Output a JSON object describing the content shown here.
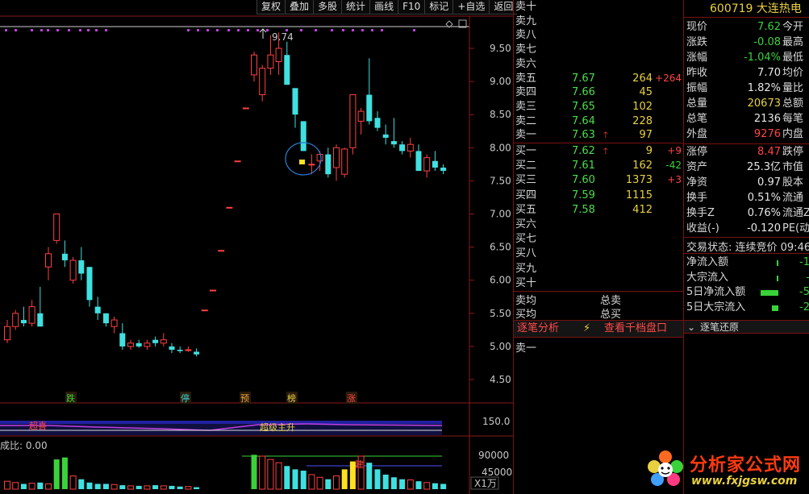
{
  "toolbar": {
    "items": [
      "复权",
      "叠加",
      "多股",
      "统计",
      "画线",
      "F10",
      "标记",
      "+自选",
      "返回"
    ]
  },
  "chart": {
    "price_labels": [
      "9.50",
      "9.00",
      "8.50",
      "8.00",
      "7.50",
      "7.00",
      "6.50",
      "6.00",
      "5.50",
      "5.00",
      "4.50"
    ],
    "max_label": "9.74",
    "tags": [
      {
        "text": "跌",
        "color": "#3ad23a"
      },
      {
        "text": "停",
        "color": "#3ad2d2"
      },
      {
        "text": "预",
        "color": "#e8a040"
      },
      {
        "text": "榜",
        "color": "#e8d040"
      },
      {
        "text": "涨",
        "color": "#ff4444"
      }
    ],
    "indicator": {
      "scale": "150.0",
      "label_left": "超喜",
      "label_right": "超级主升"
    },
    "volume": {
      "title": "成比: 0.00",
      "label_high": "90000",
      "label_mid": "45000",
      "unit": "X1万",
      "mark": "建"
    }
  },
  "chart_data": {
    "type": "candlestick",
    "ylim": [
      4.4,
      9.9
    ],
    "candles": [
      [
        5.1,
        5.4,
        5.05,
        5.3
      ],
      [
        5.3,
        5.55,
        5.25,
        5.5
      ],
      [
        5.4,
        5.6,
        5.3,
        5.35
      ],
      [
        5.35,
        5.7,
        5.3,
        5.6
      ],
      [
        5.5,
        5.9,
        5.45,
        5.3
      ],
      [
        6.2,
        6.5,
        6.0,
        6.4
      ],
      [
        6.6,
        7.0,
        6.55,
        7.0
      ],
      [
        6.4,
        6.6,
        6.2,
        6.3
      ],
      [
        6.0,
        6.35,
        5.95,
        6.3
      ],
      [
        6.3,
        6.5,
        6.0,
        6.1
      ],
      [
        6.2,
        6.2,
        5.6,
        5.7
      ],
      [
        5.6,
        5.75,
        5.4,
        5.5
      ],
      [
        5.5,
        5.5,
        5.3,
        5.35
      ],
      [
        5.3,
        5.45,
        5.2,
        5.4
      ],
      [
        5.2,
        5.35,
        4.95,
        5.0
      ],
      [
        5.0,
        5.1,
        4.95,
        5.05
      ],
      [
        5.05,
        5.1,
        4.98,
        5.0
      ],
      [
        5.0,
        5.1,
        4.95,
        5.05
      ],
      [
        5.1,
        5.15,
        5.0,
        5.05
      ],
      [
        5.05,
        5.2,
        5.0,
        5.1
      ],
      [
        5.0,
        5.05,
        4.9,
        4.95
      ],
      [
        4.95,
        5.0,
        4.9,
        4.93
      ],
      [
        4.95,
        5.0,
        4.92,
        4.95
      ],
      [
        4.92,
        4.97,
        4.85,
        4.88
      ],
      [
        5.55,
        5.55,
        5.55,
        5.55
      ],
      [
        5.85,
        5.85,
        5.85,
        5.85
      ],
      [
        6.45,
        6.45,
        6.45,
        6.45
      ],
      [
        7.1,
        7.1,
        7.1,
        7.1
      ],
      [
        7.8,
        7.8,
        7.8,
        7.8
      ],
      [
        8.6,
        8.6,
        8.6,
        8.6
      ],
      [
        9.1,
        9.45,
        9.0,
        9.4
      ],
      [
        8.8,
        9.25,
        8.7,
        9.2
      ],
      [
        9.2,
        9.7,
        9.1,
        9.4
      ],
      [
        9.3,
        9.74,
        9.1,
        9.5
      ],
      [
        9.4,
        9.6,
        8.95,
        8.95
      ],
      [
        8.9,
        8.9,
        8.3,
        8.5
      ],
      [
        8.4,
        8.4,
        7.95,
        7.95
      ],
      [
        7.75,
        7.9,
        7.6,
        7.75
      ],
      [
        7.8,
        7.95,
        7.65,
        7.9
      ],
      [
        7.9,
        8.0,
        7.55,
        7.6
      ],
      [
        7.7,
        8.05,
        7.5,
        8.0
      ],
      [
        7.6,
        8.0,
        7.55,
        7.98
      ],
      [
        8.0,
        8.8,
        7.9,
        8.8
      ],
      [
        8.4,
        8.6,
        8.2,
        8.55
      ],
      [
        8.8,
        9.35,
        8.35,
        8.4
      ],
      [
        8.45,
        8.55,
        8.25,
        8.3
      ],
      [
        8.2,
        8.35,
        8.05,
        8.15
      ],
      [
        8.1,
        8.45,
        8.0,
        8.05
      ],
      [
        8.05,
        8.1,
        7.9,
        7.95
      ],
      [
        7.95,
        8.15,
        7.85,
        8.05
      ],
      [
        7.95,
        8.05,
        7.65,
        7.65
      ],
      [
        7.65,
        7.9,
        7.55,
        7.85
      ],
      [
        7.8,
        7.95,
        7.65,
        7.7
      ],
      [
        7.7,
        7.75,
        7.6,
        7.65
      ]
    ],
    "volumes": [
      12,
      10,
      8,
      9,
      10,
      8,
      45,
      48,
      20,
      15,
      10,
      8,
      8,
      7,
      6,
      5,
      5,
      5,
      6,
      5,
      5,
      4,
      4,
      3,
      0,
      0,
      0,
      0,
      0,
      0,
      52,
      50,
      45,
      40,
      35,
      30,
      28,
      22,
      18,
      15,
      20,
      30,
      42,
      50,
      40,
      30,
      22,
      18,
      15,
      14,
      12,
      10,
      9,
      8
    ]
  },
  "book": {
    "sells": [
      {
        "label": "卖十",
        "price": "",
        "vol": "",
        "chg": ""
      },
      {
        "label": "卖九",
        "price": "",
        "vol": "",
        "chg": ""
      },
      {
        "label": "卖八",
        "price": "",
        "vol": "",
        "chg": ""
      },
      {
        "label": "卖七",
        "price": "",
        "vol": "",
        "chg": ""
      },
      {
        "label": "卖六",
        "price": "",
        "vol": "",
        "chg": ""
      },
      {
        "label": "卖五",
        "price": "7.67",
        "vol": "264",
        "chg": "+264"
      },
      {
        "label": "卖四",
        "price": "7.66",
        "vol": "45",
        "chg": ""
      },
      {
        "label": "卖三",
        "price": "7.65",
        "vol": "102",
        "chg": ""
      },
      {
        "label": "卖二",
        "price": "7.64",
        "vol": "228",
        "chg": ""
      },
      {
        "label": "卖一",
        "price": "7.63",
        "vol": "97",
        "chg": "",
        "arrow": "🡑"
      }
    ],
    "buys": [
      {
        "label": "买一",
        "price": "7.62",
        "vol": "9",
        "chg": "+9",
        "arrow": "🡑"
      },
      {
        "label": "买二",
        "price": "7.61",
        "vol": "162",
        "chg": "-42"
      },
      {
        "label": "买三",
        "price": "7.60",
        "vol": "1373",
        "chg": "+3"
      },
      {
        "label": "买四",
        "price": "7.59",
        "vol": "1115",
        "chg": ""
      },
      {
        "label": "买五",
        "price": "7.58",
        "vol": "412",
        "chg": ""
      },
      {
        "label": "买六",
        "price": "",
        "vol": "",
        "chg": ""
      },
      {
        "label": "买七",
        "price": "",
        "vol": "",
        "chg": ""
      },
      {
        "label": "买八",
        "price": "",
        "vol": "",
        "chg": ""
      },
      {
        "label": "买九",
        "price": "",
        "vol": "",
        "chg": ""
      },
      {
        "label": "买十",
        "price": "",
        "vol": "",
        "chg": ""
      }
    ],
    "avg_sell": "卖均",
    "total_sell": "总卖",
    "avg_buy": "买均",
    "total_buy": "总买",
    "tab_tick": "逐笔分析",
    "tab_depth": "查看千档盘口",
    "tick_first": "卖一"
  },
  "quote": {
    "code_name": "600719 大连热电",
    "rows": [
      {
        "k": "现价",
        "v": "7.62",
        "vc": "green",
        "k2": "今开"
      },
      {
        "k": "涨跌",
        "v": "-0.08",
        "vc": "green",
        "k2": "最高"
      },
      {
        "k": "涨幅",
        "v": "-1.04%",
        "vc": "green",
        "k2": "最低"
      },
      {
        "k": "昨收",
        "v": "7.70",
        "vc": "white",
        "k2": "均价"
      },
      {
        "k": "振幅",
        "v": "1.82%",
        "vc": "white",
        "k2": "量比"
      },
      {
        "k": "总量",
        "v": "20673",
        "vc": "yellow",
        "k2": "总额"
      },
      {
        "k": "总笔",
        "v": "2136",
        "vc": "white",
        "k2": "每笔"
      },
      {
        "k": "外盘",
        "v": "9276",
        "vc": "red",
        "k2": "内盘"
      }
    ],
    "rows2": [
      {
        "k": "涨停",
        "v": "8.47",
        "vc": "red",
        "k2": "跌停"
      },
      {
        "k": "资产",
        "v": "25.3亿",
        "vc": "white",
        "k2": "市值"
      },
      {
        "k": "净资",
        "v": "0.97",
        "vc": "white",
        "k2": "股本"
      },
      {
        "k": "换手",
        "v": "0.51%",
        "vc": "white",
        "k2": "流通"
      },
      {
        "k": "换手Z",
        "v": "0.76%",
        "vc": "white",
        "k2": "流通Z"
      },
      {
        "k": "收益(-)",
        "v": "-0.120",
        "vc": "white",
        "k2": "PE(动"
      }
    ],
    "trade_state": "交易状态: 连续竞价 09:46",
    "flows": [
      {
        "k": "净流入额",
        "bar": 0.02,
        "v": "-1"
      },
      {
        "k": "大宗流入",
        "bar": 0.0,
        "v": "-"
      },
      {
        "k": "5日净流入额",
        "bar": 0.9,
        "v": "-5"
      },
      {
        "k": "5日大宗流入",
        "bar": 0.35,
        "v": "-2"
      }
    ],
    "restore": "逐笔还原"
  },
  "watermark": {
    "title": "分析家公式网",
    "url": "www.fxjgsw.com"
  },
  "colors": {
    "up": "#ff4040",
    "down": "#40e0e0",
    "grid": "#8a1a1a",
    "green": "#3ad23a"
  }
}
